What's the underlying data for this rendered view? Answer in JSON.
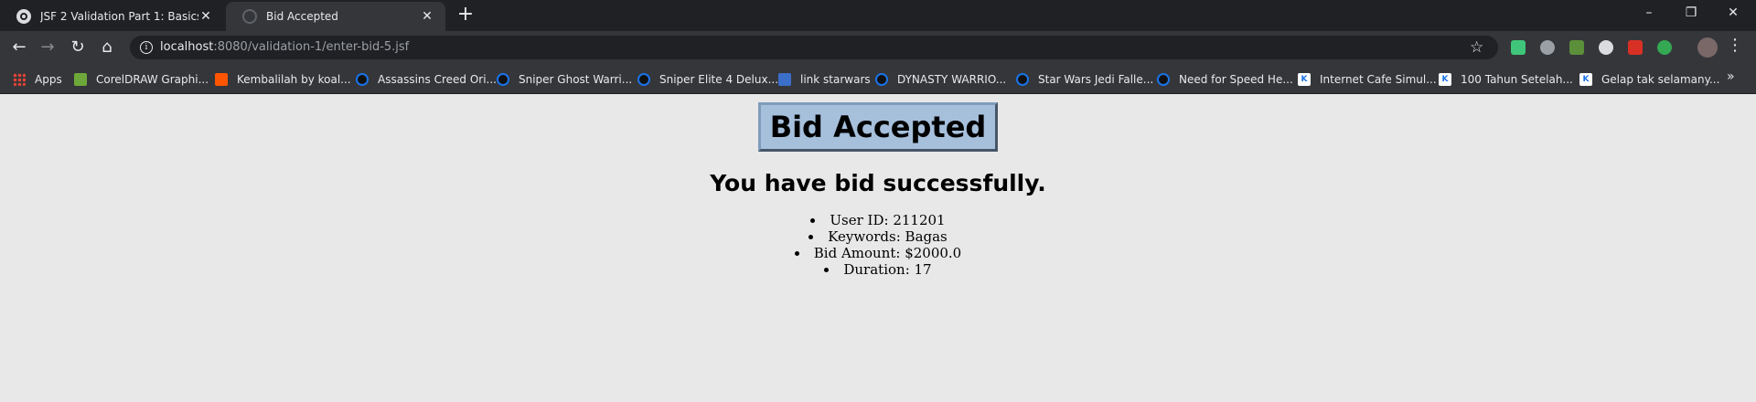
{
  "browser": {
    "tabs": [
      {
        "title": "JSF 2 Validation Part 1: Basics",
        "icon": "globe-icon",
        "active": false
      },
      {
        "title": "Bid Accepted",
        "icon": "loading-icon",
        "active": true
      }
    ],
    "new_tab_symbol": "+",
    "window_controls": {
      "minimize": "–",
      "restore": "❐",
      "close": "✕"
    },
    "address": {
      "host": "localhost",
      "path": ":8080/validation-1/enter-bid-5.jsf"
    },
    "bookmarks": [
      {
        "label": "Apps",
        "icon": "apps-grid-icon"
      },
      {
        "label": "CorelDRAW Graphi...",
        "icon": "corel-icon"
      },
      {
        "label": "Kembalilah by koal...",
        "icon": "soundcloud-icon"
      },
      {
        "label": "Assassins Creed Ori...",
        "icon": "avatar-icon"
      },
      {
        "label": "Sniper Ghost Warri...",
        "icon": "avatar-icon"
      },
      {
        "label": "Sniper Elite 4 Delux...",
        "icon": "avatar-icon"
      },
      {
        "label": "link starwars",
        "icon": "link-icon"
      },
      {
        "label": "DYNASTY WARRIO...",
        "icon": "avatar-icon"
      },
      {
        "label": "Star Wars Jedi Falle...",
        "icon": "avatar-icon"
      },
      {
        "label": "Need for Speed He...",
        "icon": "avatar-icon"
      },
      {
        "label": "Internet Cafe Simul...",
        "icon": "k-icon"
      },
      {
        "label": "100 Tahun Setelah...",
        "icon": "k-icon"
      },
      {
        "label": "Gelap tak selamany...",
        "icon": "k-icon"
      }
    ],
    "bookmarks_overflow": "»"
  },
  "page": {
    "heading": "Bid Accepted",
    "subheading": "You have bid successfully.",
    "details": [
      "User ID: 211201",
      "Keywords: Bagas",
      "Bid Amount: $2000.0",
      "Duration: 17"
    ]
  }
}
